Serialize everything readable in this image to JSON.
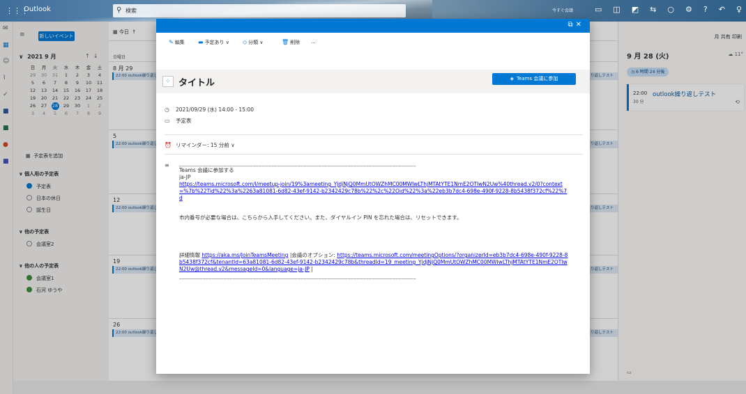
{
  "topbar": {
    "app_name": "Outlook",
    "search_placeholder": "検索",
    "hint": "今すぐ会議",
    "icons": [
      "video-icon",
      "chat-icon",
      "outlook-icon",
      "sync-icon",
      "bulb-icon",
      "gear-icon",
      "help-icon",
      "feedback-icon",
      "account-icon"
    ]
  },
  "nav": {
    "new_event": "新しいイベント",
    "month_label": "2021 9 月",
    "weekdays": [
      "日",
      "月",
      "火",
      "水",
      "木",
      "金",
      "土"
    ],
    "weeks": [
      [
        "29",
        "30",
        "31",
        "1",
        "2",
        "3",
        "4"
      ],
      [
        "5",
        "6",
        "7",
        "8",
        "9",
        "10",
        "11"
      ],
      [
        "12",
        "13",
        "14",
        "15",
        "16",
        "17",
        "18"
      ],
      [
        "19",
        "20",
        "21",
        "22",
        "23",
        "24",
        "25"
      ],
      [
        "26",
        "27",
        "28",
        "29",
        "30",
        "1",
        "2"
      ],
      [
        "3",
        "4",
        "5",
        "6",
        "7",
        "8",
        "9"
      ]
    ],
    "today": "28",
    "add_calendar": "予定表を追加",
    "groups": [
      {
        "label": "個人用の予定表",
        "items": [
          {
            "label": "予定表",
            "state": "on"
          },
          {
            "label": "日本の休日",
            "state": "off"
          },
          {
            "label": "誕生日",
            "state": "off"
          }
        ]
      },
      {
        "label": "他の予定表",
        "items": [
          {
            "label": "会議室2",
            "state": "off"
          }
        ]
      },
      {
        "label": "他の人の予定表",
        "items": [
          {
            "label": "会議室1",
            "state": "green"
          },
          {
            "label": "石河 ゆうや",
            "state": "green"
          }
        ]
      }
    ]
  },
  "calendar": {
    "today_button": "今日",
    "day_header": "日曜日",
    "weeks": [
      {
        "date": "8 月 29",
        "event": "22:00 outlook繰り返し"
      },
      {
        "date": "5",
        "event": "22:00 outlook繰り返し"
      },
      {
        "date": "12",
        "event": "22:00 outlook繰り返し"
      },
      {
        "date": "19",
        "event": "22:00 outlook繰り返し"
      },
      {
        "date": "26",
        "event": "22:00 outlook繰り返し"
      }
    ],
    "right_col_event": "り返しテスト"
  },
  "right_panel": {
    "view_toolbar": "月  共有  印刷",
    "date_title": "9 月 28 (火)",
    "weather": "11°",
    "badge": "6 時間 24 分後",
    "event": {
      "time": "22:00",
      "duration": "30 分",
      "title": "outlook繰り返しテスト"
    }
  },
  "modal": {
    "toolbar": {
      "edit": "編集",
      "status": "予定あり",
      "categorize": "分類",
      "delete": "削除",
      "more": "..."
    },
    "title": "タイトル",
    "teams_button": "Teams 会議に参加",
    "datetime": "2021/09/29 (水) 14:00 - 15:00",
    "calendar_name": "予定表",
    "reminder": "リマインダー: 15 分前",
    "body": {
      "dots": "________________________________________________________________________________",
      "join_heading": "Teams 会議に参加する",
      "locale": "ja-JP",
      "join_link": "https://teams.microsoft.com/l/meetup-join/19%3ameeting_YjdjNjQ0MmUtOWZhMC00MWIwLThjMTAtYTE1NmE2OTIwN2Uw%40thread.v2/0?context=%7b%22Tid%22%3a%2263a81081-6d82-43ef-9142-b2342429c78b%22%2c%22Oid%22%3a%22eb3b7dc4-698e-490f-9228-8b5438f372cf%22%7d",
      "dialin_text": "市内番号が必要な場合は、こちらから入手してください。また、ダイヤルイン PIN を忘れた場合は、リセットできます。",
      "info_label": "詳細情報",
      "info_link": "https://aka.ms/JoinTeamsMeeting",
      "options_sep": "|会議のオプション:",
      "options_link": "https://teams.microsoft.com/meetingOptions/?organizerId=eb3b7dc4-698e-490f-9228-8b5438f372cf&tenantId=63a81081-6d82-43ef-9142-b2342429c78b&threadId=19_meeting_YjdjNjQ0MmUtOWZhMC00MWIwLThjMTAtYTE1NmE2OTIwN2Uw@thread.v2&messageId=0&language=ja-JP",
      "tail": "|"
    }
  }
}
